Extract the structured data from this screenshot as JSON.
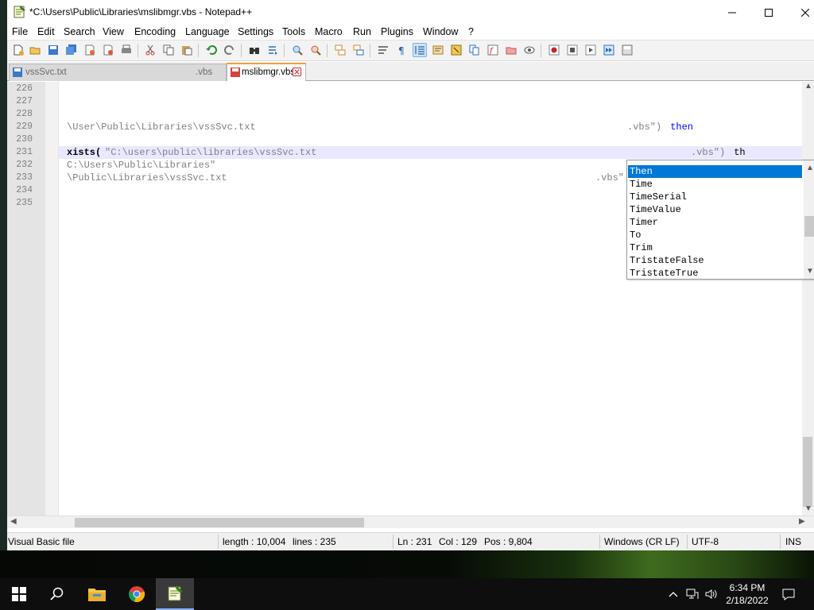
{
  "window": {
    "title": "*C:\\Users\\Public\\Libraries\\mslibmgr.vbs - Notepad++",
    "controls": {
      "minimize": "—",
      "maximize": "☐",
      "close": "✕"
    }
  },
  "menu": [
    {
      "label": "File"
    },
    {
      "label": "Edit"
    },
    {
      "label": "Search"
    },
    {
      "label": "View"
    },
    {
      "label": "Encoding"
    },
    {
      "label": "Language"
    },
    {
      "label": "Settings"
    },
    {
      "label": "Tools"
    },
    {
      "label": "Macro"
    },
    {
      "label": "Run"
    },
    {
      "label": "Plugins"
    },
    {
      "label": "Window"
    },
    {
      "label": "?"
    }
  ],
  "toolbar_icons": [
    "new-file-icon",
    "open-file-icon",
    "save-icon",
    "save-all-icon",
    "close-file-icon",
    "close-all-icon",
    "print-icon",
    "cut-icon",
    "copy-icon",
    "paste-icon",
    "undo-icon",
    "redo-icon",
    "find-icon",
    "replace-icon",
    "zoom-in-icon",
    "zoom-out-icon",
    "sync-vertical-icon",
    "sync-horizontal-icon",
    "word-wrap-icon",
    "show-all-chars-icon",
    "indent-guide-icon",
    "udl-icon",
    "doc-map-icon",
    "document-list-icon",
    "function-list-icon",
    "folder-workspace-icon",
    "monitoring-icon",
    "record-macro-icon",
    "stop-macro-icon",
    "play-macro-icon",
    "run-macro-multiple-icon",
    "save-macro-icon"
  ],
  "tabs": [
    {
      "label": "vssSvc.txt",
      "suffix": ".vbs",
      "active": false
    },
    {
      "label": "mslibmgr.vbs",
      "active": true
    }
  ],
  "editor": {
    "lines": [
      {
        "num": "226",
        "segments": []
      },
      {
        "num": "227",
        "segments": []
      },
      {
        "num": "228",
        "segments": []
      },
      {
        "num": "229",
        "segments": [
          {
            "text": "\\User\\Public\\Libraries\\vssSvc.txt",
            "style": "str",
            "col": 0
          },
          {
            "text": ".vbs\")",
            "style": "str",
            "col": 705
          },
          {
            "text": " then",
            "style": "kw",
            "col": 752
          }
        ]
      },
      {
        "num": "230",
        "segments": []
      },
      {
        "num": "231",
        "current": true,
        "segments": [
          {
            "text": "xists(",
            "style": "bold",
            "col": 0
          },
          {
            "text": "\"C:\\users\\public\\libraries\\vssSvc.txt",
            "style": "str",
            "col": 48
          },
          {
            "text": ".vbs\")",
            "style": "str",
            "col": 785
          },
          {
            "text": " th",
            "style": "plain",
            "col": 832
          }
        ]
      },
      {
        "num": "232",
        "segments": [
          {
            "text": "C:\\Users\\Public\\Libraries\"",
            "style": "str",
            "col": 0
          }
        ]
      },
      {
        "num": "233",
        "segments": [
          {
            "text": "\\Public\\Libraries\\vssSvc.txt",
            "style": "str",
            "col": 0
          },
          {
            "text": ".vbs\"",
            "style": "str",
            "col": 665
          }
        ]
      },
      {
        "num": "234",
        "segments": []
      },
      {
        "num": "235",
        "segments": []
      }
    ]
  },
  "autocomplete": {
    "selected": "Then",
    "items": [
      "Then",
      "Time",
      "TimeSerial",
      "TimeValue",
      "Timer",
      "To",
      "Trim",
      "TristateFalse",
      "TristateTrue"
    ]
  },
  "status": {
    "language": "Visual Basic file",
    "length": "length : 10,004",
    "lines": "lines : 235",
    "ln": "Ln : 231",
    "col": "Col : 129",
    "pos": "Pos : 9,804",
    "eol": "Windows (CR LF)",
    "encoding": "UTF-8",
    "mode": "INS"
  },
  "taskbar": {
    "items": [
      "start-icon",
      "search-icon",
      "file-explorer-icon",
      "chrome-icon",
      "notepadpp-icon"
    ],
    "time": "6:34 PM",
    "date": "2/18/2022"
  },
  "colors": {
    "selection": "#0078d7",
    "keyword": "#0000ff",
    "string": "#808080",
    "current_line": "#e8e8ff",
    "active_tab_accent": "#f0a03c"
  }
}
